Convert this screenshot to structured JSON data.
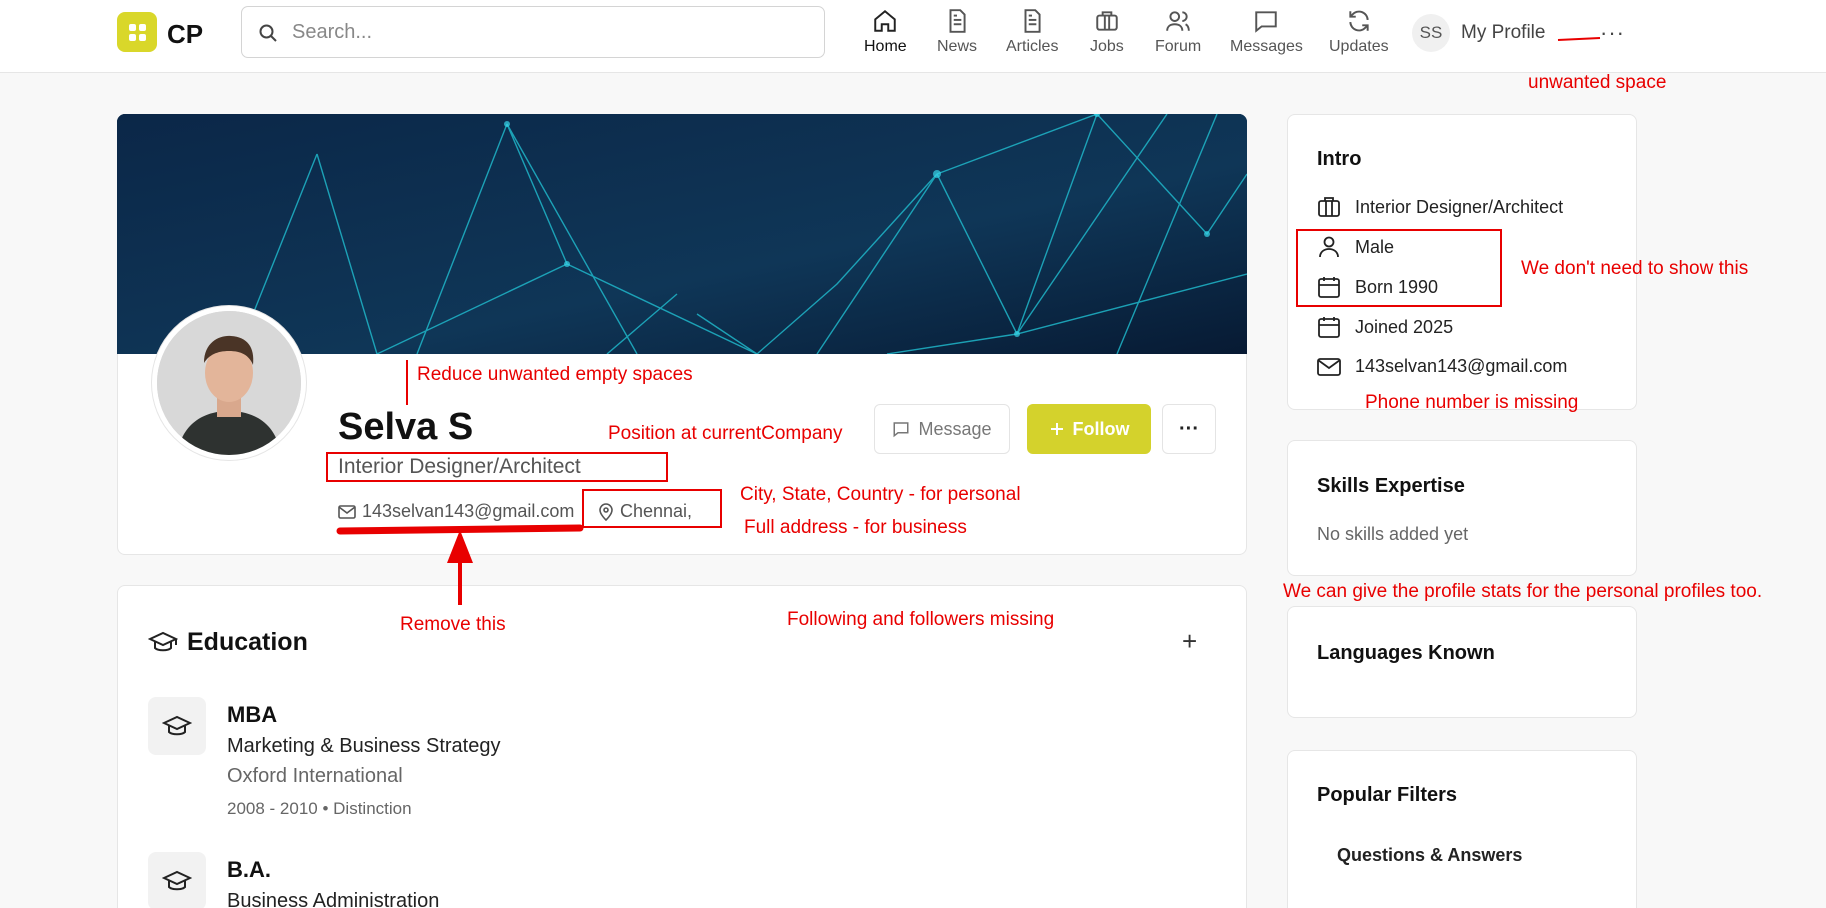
{
  "header": {
    "logo_text": "CP",
    "search_placeholder": "Search...",
    "nav": [
      {
        "label": "Home",
        "icon": "home-icon"
      },
      {
        "label": "News",
        "icon": "news-icon"
      },
      {
        "label": "Articles",
        "icon": "articles-icon"
      },
      {
        "label": "Jobs",
        "icon": "briefcase-icon"
      },
      {
        "label": "Forum",
        "icon": "users-icon"
      },
      {
        "label": "Messages",
        "icon": "chat-icon"
      },
      {
        "label": "Updates",
        "icon": "refresh-icon"
      }
    ],
    "avatar_initials": "SS",
    "profile_label": "My Profile",
    "more": "···"
  },
  "profile": {
    "name": "Selva S",
    "headline": "Interior Designer/Architect",
    "email": "143selvan143@gmail.com",
    "location": "Chennai,",
    "message_label": "Message",
    "follow_label": "Follow",
    "more_label": "···"
  },
  "education": {
    "title": "Education",
    "add": "+",
    "items": [
      {
        "degree": "MBA",
        "field": "Marketing & Business Strategy",
        "school": "Oxford International",
        "years": "2008 - 2010 • Distinction"
      },
      {
        "degree": "B.A.",
        "field": "Business Administration"
      }
    ]
  },
  "intro": {
    "title": "Intro",
    "rows": [
      {
        "icon": "briefcase-icon",
        "text": "Interior Designer/Architect"
      },
      {
        "icon": "person-icon",
        "text": "Male"
      },
      {
        "icon": "calendar-icon",
        "text": "Born 1990"
      },
      {
        "icon": "calendar-icon",
        "text": "Joined 2025"
      },
      {
        "icon": "mail-icon",
        "text": "143selvan143@gmail.com"
      }
    ]
  },
  "skills": {
    "title": "Skills Expertise",
    "empty": "No skills added yet"
  },
  "languages": {
    "title": "Languages Known"
  },
  "filters": {
    "title": "Popular Filters",
    "items": [
      "Questions & Answers"
    ]
  },
  "annotations": {
    "unwanted_space": "unwanted space",
    "no_need": "We don't need to show this",
    "phone_missing": "Phone number is missing",
    "reduce_space": "Reduce unwanted empty spaces",
    "position": "Position at currentCompany",
    "city_state": "City, State, Country - for personal",
    "full_address": "Full address - for business",
    "remove_this": "Remove this",
    "following": "Following and followers missing",
    "profile_stats": "We can give the profile stats for the personal profiles too."
  },
  "colors": {
    "accent": "#d4d22c",
    "annotation": "#e80000"
  }
}
